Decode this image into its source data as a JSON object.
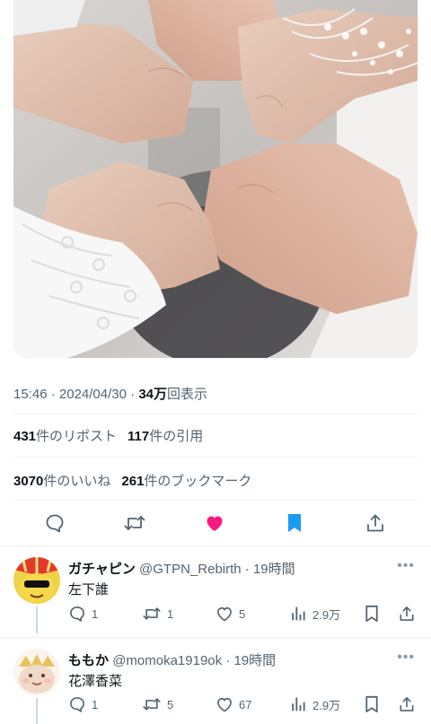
{
  "tweet": {
    "time": "15:46",
    "date": "2024/04/30",
    "views_count": "34万",
    "views_label": "回表示",
    "reposts_count": "431",
    "reposts_label": "件のリポスト",
    "quotes_count": "117",
    "quotes_label": "件の引用",
    "likes_count": "3070",
    "likes_label": "件のいいね",
    "bookmarks_count": "261",
    "bookmarks_label": "件のブックマーク",
    "liked": true,
    "bookmarked": true,
    "accent_color": "#1d9bf0",
    "like_color": "#f91880"
  },
  "replies": [
    {
      "name": "ガチャピン",
      "handle": "@GTPN_Rebirth",
      "time": "19時間",
      "text": "左下誰",
      "reply_count": "1",
      "retweet_count": "1",
      "like_count": "5",
      "view_count": "2.9万",
      "avatar": "yellow-character-with-sunglasses"
    },
    {
      "name": "ももか",
      "handle": "@momoka1919ok",
      "time": "19時間",
      "text": "花澤香菜",
      "reply_count": "1",
      "retweet_count": "5",
      "like_count": "67",
      "view_count": "2.9万",
      "avatar": "cartoon-face-with-crown"
    }
  ],
  "icons": {
    "reply": "speech-bubble-icon",
    "retweet": "retweet-arrows-icon",
    "like": "heart-icon",
    "bookmark": "bookmark-icon",
    "share": "share-upload-icon",
    "views": "bar-chart-icon",
    "more": "more-dots-icon"
  }
}
